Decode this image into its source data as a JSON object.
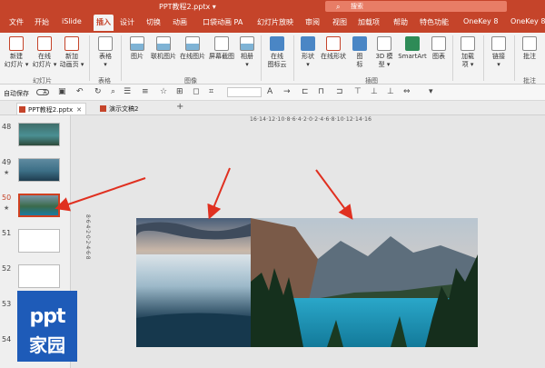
{
  "window": {
    "filename": "PPT教程2.pptx",
    "filename_caret": "▾",
    "search_placeholder": "搜索"
  },
  "ribbon_tabs": [
    "文件",
    "开始",
    "iSlide",
    "插入",
    "设计",
    "切换",
    "动画",
    "口袋动画 PA",
    "幻灯片放映",
    "审阅",
    "视图",
    "加载项",
    "帮助",
    "特色功能",
    "OneKey 8",
    "OneKey 8"
  ],
  "ribbon_tabs_active_index": 3,
  "ribbon": {
    "slides": {
      "new_slide": "新建\n幻灯片 ▾",
      "online_slide": "在线\n幻灯片 ▾",
      "new_animation": "新加\n动画页 ▾",
      "group": "幻灯片"
    },
    "tables": {
      "table": "表格\n▾",
      "group": "表格"
    },
    "images": {
      "picture": "图片",
      "online_picture": "联机图片",
      "online_image": "在线图片",
      "screenshot": "屏幕截图",
      "album": "相册\n▾",
      "group": "图像"
    },
    "cloud": {
      "cloud_icon": "在线\n图标云"
    },
    "illustrations": {
      "shapes": "形状\n▾",
      "online_shapes": "在线形状",
      "icons": "图\n标",
      "model3d": "3D 模\n型 ▾",
      "smartart": "SmartArt",
      "chart": "图表",
      "group": "插图"
    },
    "addins": {
      "addins": "加载\n项 ▾"
    },
    "links": {
      "link": "链接\n▾"
    },
    "comments": {
      "comment": "批注",
      "group": "批注"
    }
  },
  "qat": {
    "autosave": "自动保存",
    "autosave_state": "关"
  },
  "doc_tabs": [
    {
      "label": "PPT教程2.pptx",
      "close": "✕"
    },
    {
      "label": "演示文稿2",
      "close": ""
    }
  ],
  "new_tab": "+",
  "slides": [
    {
      "number": "48",
      "star": "",
      "selected": false,
      "colors": [
        "#3f6e6a",
        "#4a8f93",
        "#2e4a3a"
      ]
    },
    {
      "number": "49",
      "star": "★",
      "selected": false,
      "colors": [
        "#5f8aa0",
        "#3c6f86",
        "#1f3d4f"
      ]
    },
    {
      "number": "50",
      "star": "★",
      "selected": true,
      "colors": [
        "#7a96a8",
        "#3a6a4a",
        "#1b7aa0"
      ]
    },
    {
      "number": "51",
      "star": "",
      "selected": false,
      "colors": [
        "#ffffff",
        "#ffffff",
        "#ffffff"
      ]
    },
    {
      "number": "52",
      "star": "",
      "selected": false,
      "colors": [
        "#ffffff",
        "#ffffff",
        "#ffffff"
      ]
    },
    {
      "number": "53",
      "star": "",
      "selected": false,
      "colors": [
        "#ffffff",
        "#ffffff",
        "#ffffff"
      ]
    },
    {
      "number": "54",
      "star": "",
      "selected": false,
      "colors": [
        "#ffffff",
        "#ffffff",
        "#ffffff"
      ]
    }
  ],
  "rulers": {
    "horizontal": "16·14·12·10·8·6·4·2·0·2·4·6·8·10·12·14·16",
    "vertical": "8·6·4·2·0·2·4·6·8"
  },
  "watermark": {
    "line1": "ppt",
    "line2": "家园"
  },
  "colors": {
    "accent": "#c5442a",
    "arrow": "#e03020",
    "logo": "#1e5bb8"
  }
}
